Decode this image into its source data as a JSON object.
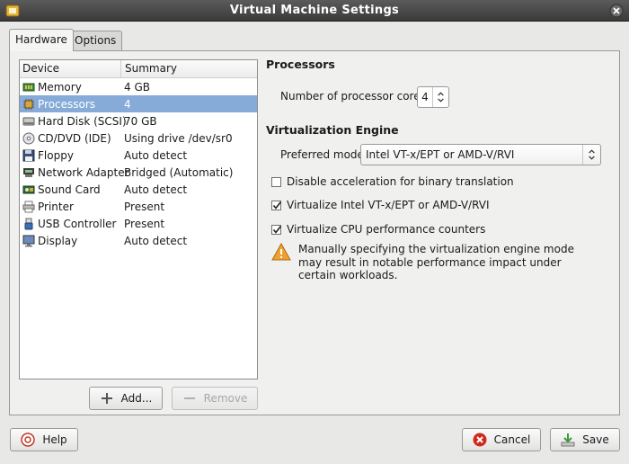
{
  "window": {
    "title": "Virtual Machine Settings"
  },
  "tabs": [
    {
      "label": "Hardware",
      "active": true
    },
    {
      "label": "Options",
      "active": false
    }
  ],
  "device_list": {
    "columns": [
      "Device",
      "Summary"
    ],
    "rows": [
      {
        "device": "Memory",
        "summary": "4 GB",
        "icon": "memory-icon"
      },
      {
        "device": "Processors",
        "summary": "4",
        "icon": "processor-icon",
        "selected": true
      },
      {
        "device": "Hard Disk (SCSI)",
        "summary": "70 GB",
        "icon": "hard-disk-icon"
      },
      {
        "device": "CD/DVD (IDE)",
        "summary": "Using drive /dev/sr0",
        "icon": "cd-dvd-icon"
      },
      {
        "device": "Floppy",
        "summary": "Auto detect",
        "icon": "floppy-icon"
      },
      {
        "device": "Network Adapter",
        "summary": "Bridged (Automatic)",
        "icon": "network-adapter-icon"
      },
      {
        "device": "Sound Card",
        "summary": "Auto detect",
        "icon": "sound-card-icon"
      },
      {
        "device": "Printer",
        "summary": "Present",
        "icon": "printer-icon"
      },
      {
        "device": "USB Controller",
        "summary": "Present",
        "icon": "usb-icon"
      },
      {
        "device": "Display",
        "summary": "Auto detect",
        "icon": "display-icon"
      }
    ]
  },
  "buttons": {
    "add": "Add...",
    "remove": "Remove",
    "help": "Help",
    "cancel": "Cancel",
    "save": "Save"
  },
  "processors": {
    "section_title": "Processors",
    "cores_label": "Number of processor cores:",
    "cores_value": "4"
  },
  "virtualization": {
    "section_title": "Virtualization Engine",
    "mode_label": "Preferred mode:",
    "mode_value": "Intel VT-x/EPT or AMD-V/RVI",
    "options": [
      {
        "label": "Disable acceleration for binary translation",
        "checked": false
      },
      {
        "label": "Virtualize Intel VT-x/EPT or AMD-V/RVI",
        "checked": true
      },
      {
        "label": "Virtualize CPU performance counters",
        "checked": true
      }
    ],
    "warning": "Manually specifying the virtualization engine mode may result in notable performance impact under certain workloads."
  },
  "colors": {
    "selection": "#86abd9",
    "titlebar": "#4a4a4a",
    "warning": "#f0a030"
  }
}
